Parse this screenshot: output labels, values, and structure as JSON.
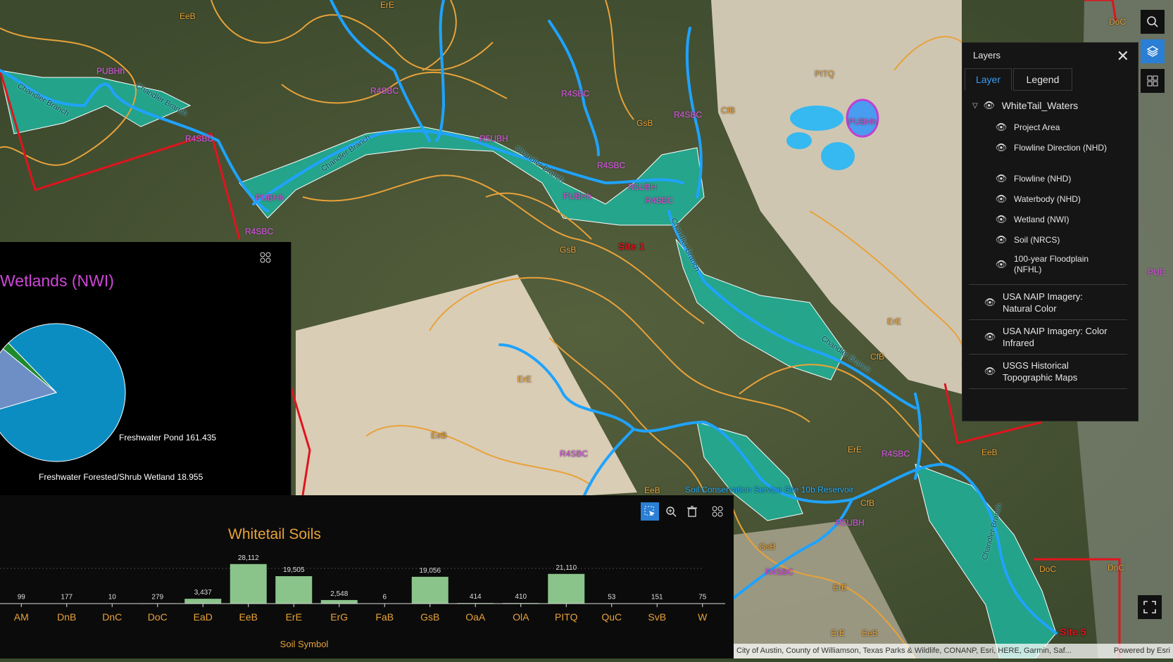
{
  "map": {
    "soil_labels": [
      "EeB",
      "ErE",
      "PITQ",
      "GsB",
      "CfB",
      "ErE",
      "GsB",
      "ErE",
      "EeB",
      "EeB",
      "CfB",
      "ErE",
      "EeB",
      "CfB",
      "GsB",
      "ErE",
      "DoC",
      "DnC",
      "DoC",
      "EeB",
      "ErE"
    ],
    "wetland_labels": [
      "PUBHh",
      "R4SBC",
      "R4SBC",
      "R4SBC",
      "R4SBC",
      "R5UBH",
      "R4SBC",
      "PUBHh",
      "R5UBH",
      "R4SBC",
      "PUBHh",
      "R4SBC",
      "PUBHh",
      "R4SBC",
      "R4SBC",
      "R5UBH",
      "R4SBC",
      "PUBHh",
      "PUE"
    ],
    "flowline_labels": [
      "Chandler Branch",
      "Chandler Branch",
      "Chandler Branch",
      "Chandler Branch",
      "Chandler Branch",
      "Chandler Branch",
      "Chandler Branch",
      "Soil Conservation Service Site 10b Reservoir"
    ],
    "site_labels": [
      "Site 1",
      "Site 5"
    ]
  },
  "toolbar": {
    "search_icon": "search-icon",
    "layers_icon": "layers-icon",
    "basemap_icon": "basemap-gallery-icon",
    "fullscreen_icon": "fullscreen-icon"
  },
  "layers_panel": {
    "title": "Layers",
    "tabs": [
      "Layer",
      "Legend"
    ],
    "group": "WhiteTail_Waters",
    "sublayers": [
      "Project Area",
      "Flowline Direction (NHD)",
      "Flowline (NHD)",
      "Waterbody (NHD)",
      "Wetland (NWI)",
      "Soil (NRCS)",
      "100-year Floodplain (NFHL)"
    ],
    "basemaps": [
      "USA NAIP Imagery: Natural Color",
      "USA NAIP Imagery: Color Infrared",
      "USGS Historical Topographic Maps"
    ]
  },
  "chart_data": [
    {
      "type": "pie",
      "title": "Wetlands (NWI)",
      "slices": [
        {
          "label": "",
          "value": 864.0,
          "color": "#0b8dc2"
        },
        {
          "label": "Freshwater Pond",
          "value": 161.435,
          "color": "#6d8fc6"
        },
        {
          "label": "Freshwater Forested/Shrub Wetland",
          "value": 18.955,
          "color": "#1e8a2e"
        }
      ],
      "annotations": [
        "Freshwater Pond 161.435",
        "Freshwater Forested/Shrub Wetland 18.955"
      ]
    },
    {
      "type": "bar",
      "title": "Whitetail Soils",
      "xlabel": "Soil Symbol",
      "categories": [
        "AM",
        "DnB",
        "DnC",
        "DoC",
        "EaD",
        "EeB",
        "ErE",
        "ErG",
        "FaB",
        "GsB",
        "OaA",
        "OlA",
        "PITQ",
        "QuC",
        "SvB",
        "W"
      ],
      "values": [
        99,
        177,
        10,
        279,
        3437,
        28112,
        19505,
        2548,
        6,
        19056,
        414,
        410,
        21110,
        53,
        151,
        75
      ],
      "value_labels": [
        "99",
        "177",
        "10",
        "279",
        "3,437",
        "28,112",
        "19,505",
        "2,548",
        "6",
        "19,056",
        "414",
        "410",
        "21,110",
        "53",
        "151",
        "75"
      ],
      "ylim": [
        0,
        30000
      ],
      "color": "#8ac48a"
    }
  ],
  "attribution": {
    "sources": "City of Austin, County of Williamson, Texas Parks & Wildlife, CONANP, Esri, HERE, Garmin, Saf...",
    "powered": "Powered by Esri"
  }
}
